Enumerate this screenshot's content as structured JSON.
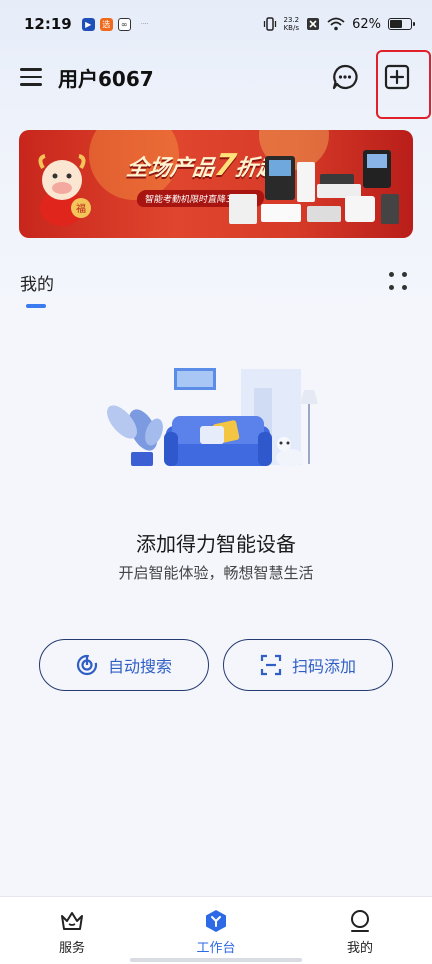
{
  "status_bar": {
    "time": "12:19",
    "net_speed_value": "23.2",
    "net_speed_unit": "KB/s",
    "battery": "62%",
    "battery_level": 0.62
  },
  "header": {
    "title": "用户6067"
  },
  "banner": {
    "headline_prefix": "全场产品",
    "headline_big": "7",
    "headline_suffix": "折起",
    "subline": "智能考勤机限时直降300元!",
    "mascot_text": "福"
  },
  "section": {
    "title": "我的"
  },
  "empty_state": {
    "title": "添加得力智能设备",
    "subtitle": "开启智能体验，畅想智慧生活"
  },
  "actions": {
    "auto_search": "自动搜索",
    "scan_add": "扫码添加"
  },
  "bottom_nav": {
    "items": [
      {
        "label": "服务",
        "icon": "crown-icon"
      },
      {
        "label": "工作台",
        "icon": "workbench-icon"
      },
      {
        "label": "我的",
        "icon": "profile-icon"
      }
    ],
    "active_index": 1
  },
  "colors": {
    "accent": "#2f6ae6",
    "highlight_border": "#e0202a",
    "banner_red": "#d63a28"
  }
}
